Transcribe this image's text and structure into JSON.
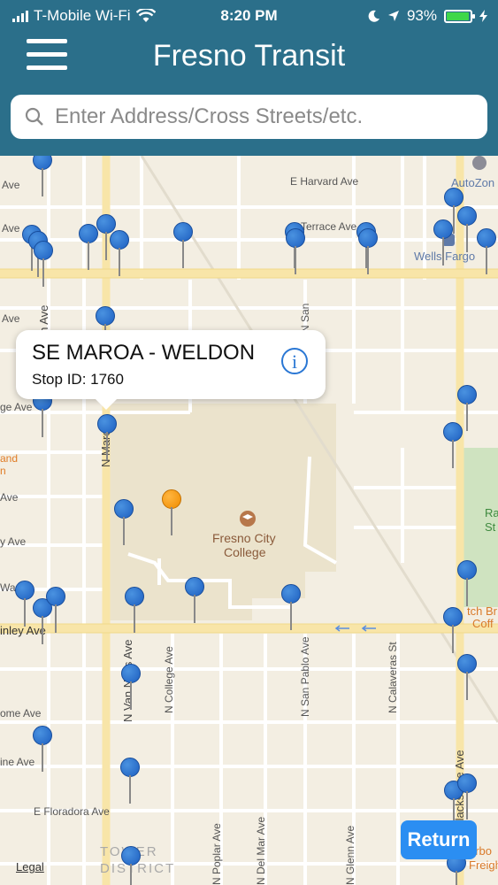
{
  "status_bar": {
    "carrier": "T-Mobile Wi-Fi",
    "time": "8:20 PM",
    "battery": "93%"
  },
  "header": {
    "title": "Fresno Transit",
    "menu_icon": "hamburger-menu-icon"
  },
  "search": {
    "placeholder": "Enter Address/Cross Streets/etc."
  },
  "map": {
    "street_labels": {
      "e_harvard": "E Harvard Ave",
      "terrace": "Terrace Ave",
      "wishon": "N Wishon Ave",
      "maroa": "N Maroa",
      "van_ness": "N Van Ness Ave",
      "college": "N College Ave",
      "san_pablo": "N San Pablo Ave",
      "calaveras": "N Calaveras St",
      "san_short": "N San",
      "floradora": "E Floradora Ave",
      "mckinley": "inley Ave",
      "poplar": "N Poplar Ave",
      "del_mar": "N Del Mar Ave",
      "glenn": "N Glenn Ave",
      "blackstone": "Blackstone Ave",
      "ave1": "Ave",
      "ave2": "Ave",
      "ave3": "Ave",
      "ave4": "ge Ave",
      "ave5": "Ave",
      "ave6": "y Ave",
      "ome": "ome Ave",
      "ine": "ine Ave",
      "wa": "Wa"
    },
    "poi": {
      "college_line1": "Fresno City",
      "college_line2": "College",
      "wells_fargo": "Wells Fargo",
      "autozone": "AutoZon",
      "tower_line1": "TOWER",
      "tower_line2": "DISTRICT",
      "and": "and",
      "n_char": "n",
      "ra": "Ra",
      "st": "St",
      "tch_br": "tch Br",
      "coff": "Coff",
      "arbo": "arbo",
      "freig": "Freigh"
    }
  },
  "callout": {
    "title": "SE MAROA - WELDON",
    "stop_id": "Stop ID: 1760"
  },
  "return_button": "Return",
  "legal_link": "Legal"
}
